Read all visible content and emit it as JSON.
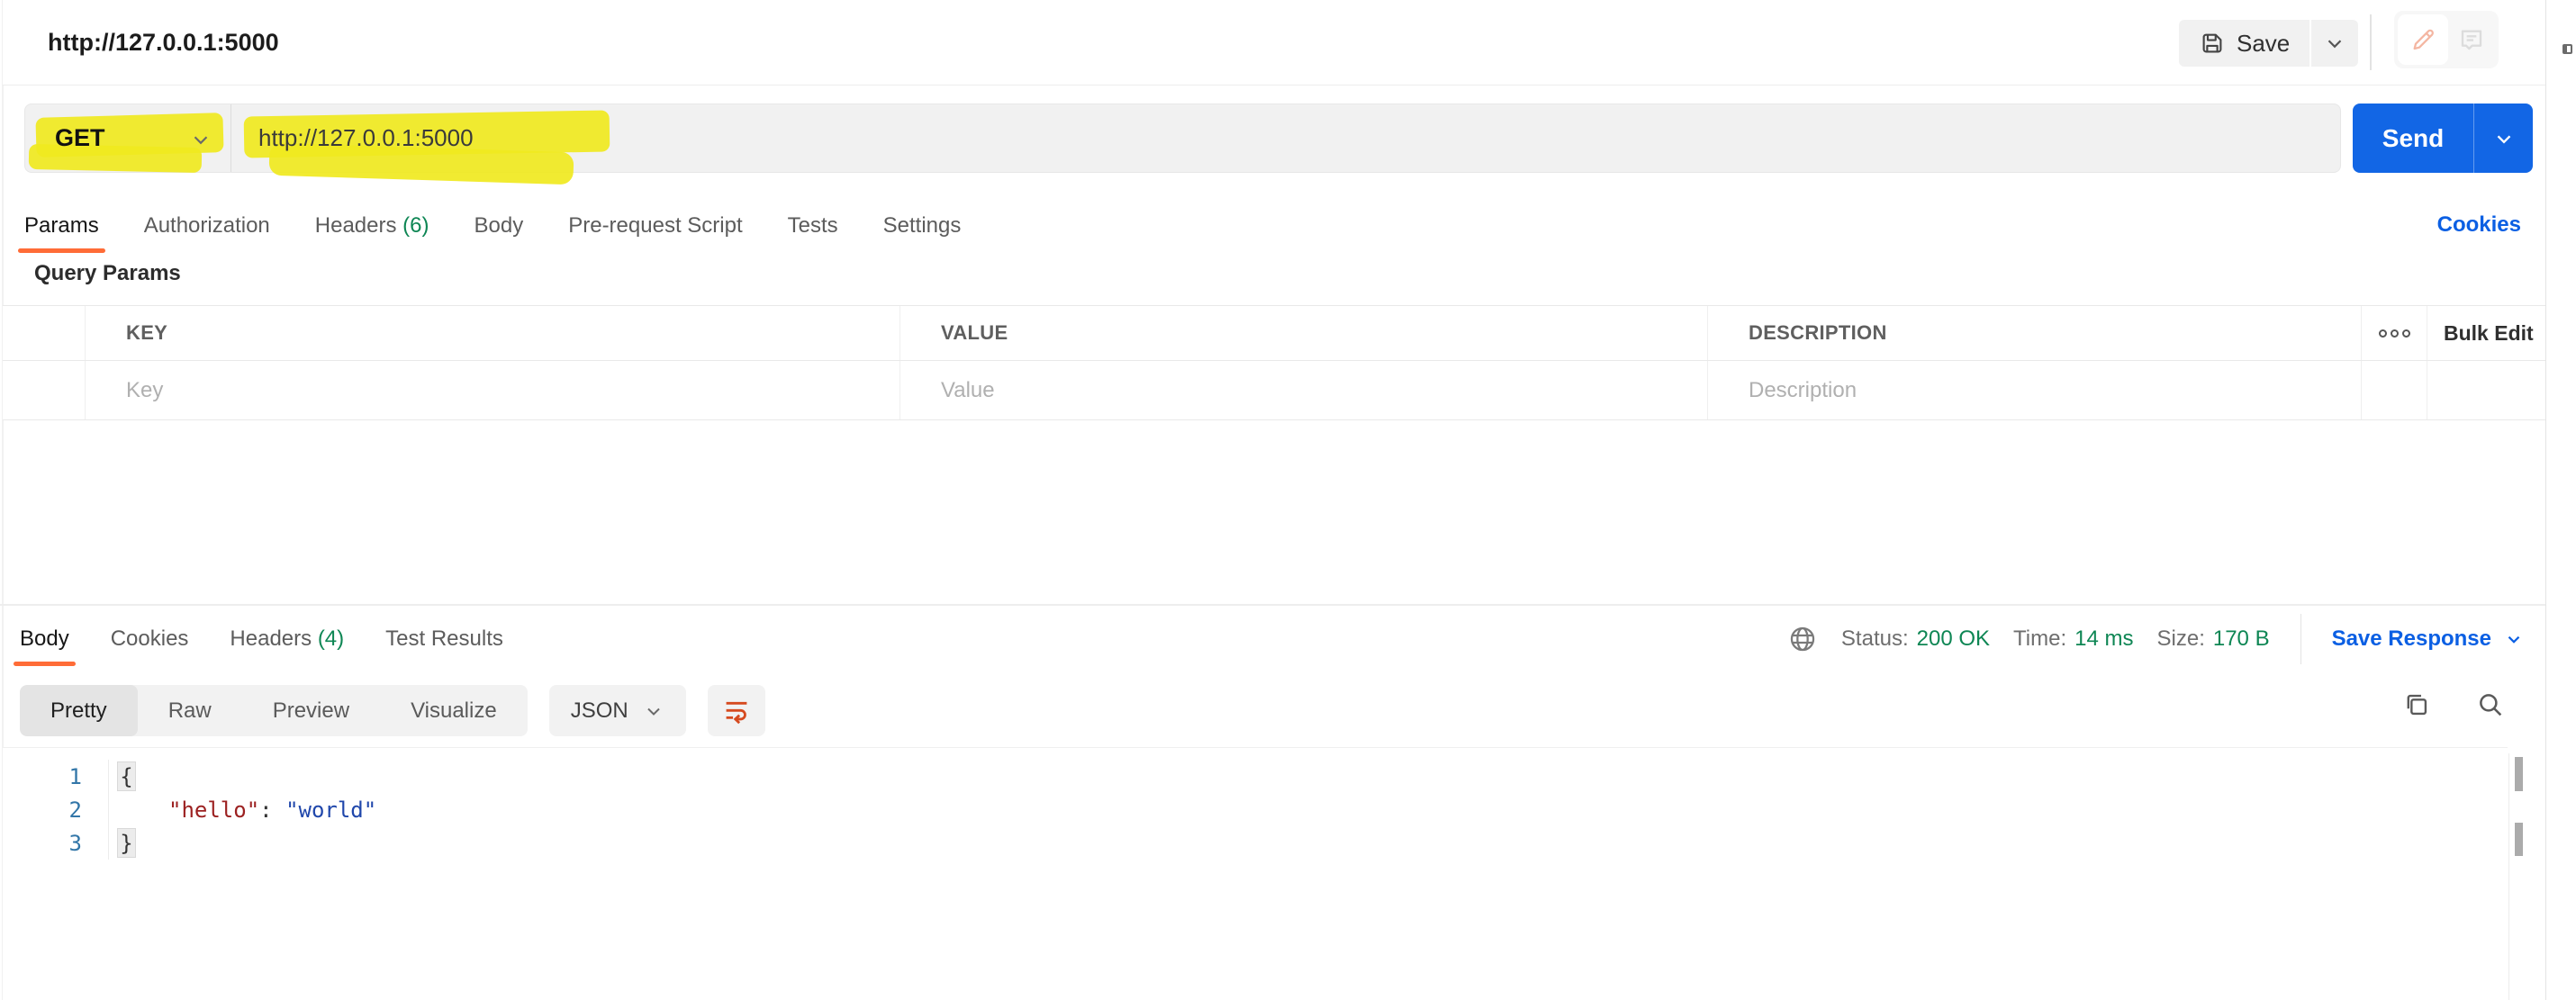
{
  "header": {
    "title": "http://127.0.0.1:5000",
    "save_label": "Save"
  },
  "request": {
    "method": "GET",
    "url": "http://127.0.0.1:5000",
    "send_label": "Send"
  },
  "request_tabs": [
    {
      "label": "Params",
      "active": true
    },
    {
      "label": "Authorization"
    },
    {
      "label": "Headers",
      "count": "(6)"
    },
    {
      "label": "Body"
    },
    {
      "label": "Pre-request Script"
    },
    {
      "label": "Tests"
    },
    {
      "label": "Settings"
    }
  ],
  "cookies_link": "Cookies",
  "query_params": {
    "heading": "Query Params",
    "columns": {
      "key": "KEY",
      "value": "VALUE",
      "description": "DESCRIPTION"
    },
    "bulk_edit_label": "Bulk Edit",
    "placeholders": {
      "key": "Key",
      "value": "Value",
      "description": "Description"
    }
  },
  "response": {
    "tabs": [
      {
        "label": "Body",
        "active": true
      },
      {
        "label": "Cookies"
      },
      {
        "label": "Headers",
        "count": "(4)"
      },
      {
        "label": "Test Results"
      }
    ],
    "status": {
      "status_label": "Status:",
      "status_value": "200 OK",
      "time_label": "Time:",
      "time_value": "14 ms",
      "size_label": "Size:",
      "size_value": "170 B"
    },
    "save_response_label": "Save Response",
    "view_tabs": {
      "pretty": "Pretty",
      "raw": "Raw",
      "preview": "Preview",
      "visualize": "Visualize"
    },
    "format_selector": "JSON",
    "code": {
      "lines": [
        {
          "num": "1",
          "text": "{"
        },
        {
          "num": "2",
          "key": "\"hello\"",
          "colon": ": ",
          "value": "\"world\""
        },
        {
          "num": "3",
          "text": "}"
        }
      ]
    }
  },
  "icons": {
    "save": "floppy-disk",
    "edit": "pencil",
    "comment": "speech-bubble",
    "more_options": "three-circles",
    "network": "globe",
    "wrap": "wrap-lines",
    "copy": "overlapping-squares",
    "search": "magnifier",
    "dropdown": "chevron-down"
  },
  "colors": {
    "accent_orange": "#FF6C37",
    "primary_blue": "#1266E5",
    "success_green": "#0E8654",
    "highlight_yellow": "#F0E920",
    "wrap_icon_orange": "#D64A1F",
    "code_key": "#9C2121",
    "code_string": "#2047AB",
    "line_number": "#3276A8"
  }
}
